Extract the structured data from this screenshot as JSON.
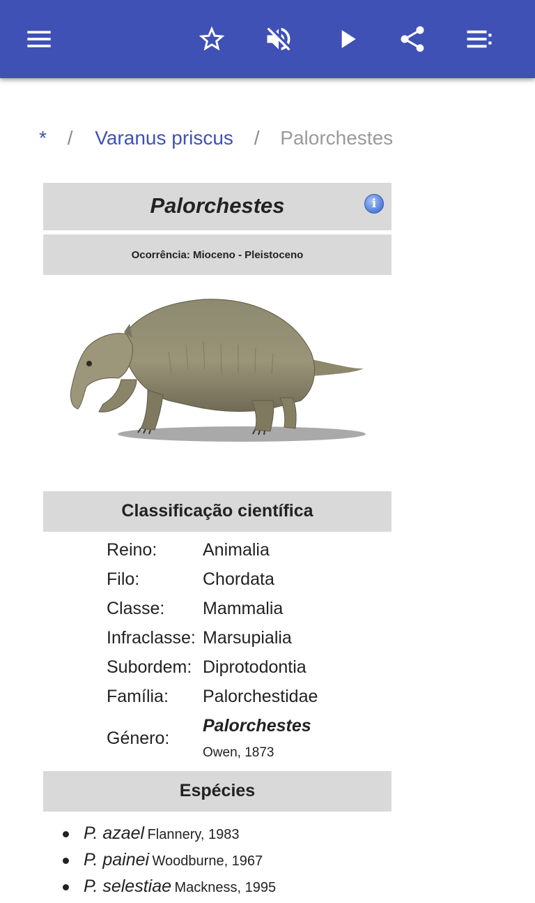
{
  "toolbar": {
    "icons": [
      "menu-icon",
      "star-outline-icon",
      "volume-off-icon",
      "play-icon",
      "share-icon",
      "playlist-icon"
    ]
  },
  "breadcrumb": {
    "home": "*",
    "separator": "/",
    "parent": "Varanus priscus",
    "current": "Palorchestes"
  },
  "infobox": {
    "title": "Palorchestes",
    "info_icon": "i",
    "occurrence": "Ocorrência: Mioceno - Pleistoceno",
    "classification_header": "Classificação científica",
    "taxonomy": [
      {
        "label": "Reino:",
        "value": "Animalia"
      },
      {
        "label": "Filo:",
        "value": "Chordata"
      },
      {
        "label": "Classe:",
        "value": "Mammalia"
      },
      {
        "label": "Infraclasse:",
        "value": "Marsupialia"
      },
      {
        "label": "Subordem:",
        "value": "Diprotodontia"
      },
      {
        "label": "Família:",
        "value": "Palorchestidae"
      }
    ],
    "genus": {
      "label": "Género:",
      "name": "Palorchestes",
      "authority": "Owen, 1873"
    },
    "species_header": "Espécies",
    "species": [
      {
        "name": "P. azael",
        "authority": "Flannery, 1983"
      },
      {
        "name": "P. painei",
        "authority": "Woodburne, 1967"
      },
      {
        "name": "P. selestiae",
        "authority": "Mackness, 1995"
      }
    ]
  },
  "colors": {
    "appbar": "#3f51b5",
    "link": "#3f51b5",
    "header_bg": "#d9d9d9"
  }
}
